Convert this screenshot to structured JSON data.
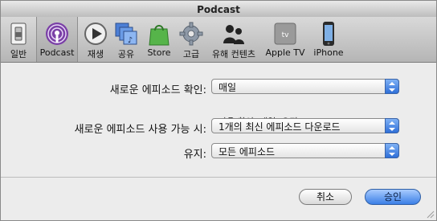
{
  "window": {
    "title": "Podcast"
  },
  "toolbar": {
    "items": [
      {
        "id": "general",
        "label": "일반",
        "icon": "switch-icon"
      },
      {
        "id": "podcast",
        "label": "Podcast",
        "icon": "podcast-icon",
        "selected": true
      },
      {
        "id": "playback",
        "label": "재생",
        "icon": "play-icon"
      },
      {
        "id": "sharing",
        "label": "공유",
        "icon": "sharing-icon"
      },
      {
        "id": "store",
        "label": "Store",
        "icon": "shopping-bag-icon"
      },
      {
        "id": "advanced",
        "label": "고급",
        "icon": "gear-icon"
      },
      {
        "id": "parental",
        "label": "유해 컨텐츠",
        "icon": "parental-icon"
      },
      {
        "id": "appletv",
        "label": "Apple TV",
        "icon": "apple-tv-icon"
      },
      {
        "id": "iphone",
        "label": "iPhone",
        "icon": "iphone-icon"
      }
    ]
  },
  "settings": {
    "check_new": {
      "label": "새로운 에피소드 확인:",
      "value": "매일",
      "note": "다음 확인: 내일, 오전 9:00"
    },
    "when_available": {
      "label": "새로운 에피소드 사용 가능 시:",
      "value": "1개의 최신 에피소드 다운로드"
    },
    "keep": {
      "label": "유지:",
      "value": "모든 에피소드"
    }
  },
  "buttons": {
    "cancel": "취소",
    "ok": "승인"
  },
  "colors": {
    "accent": "#3b7fe6",
    "toolbar": "#c8c8c8"
  }
}
